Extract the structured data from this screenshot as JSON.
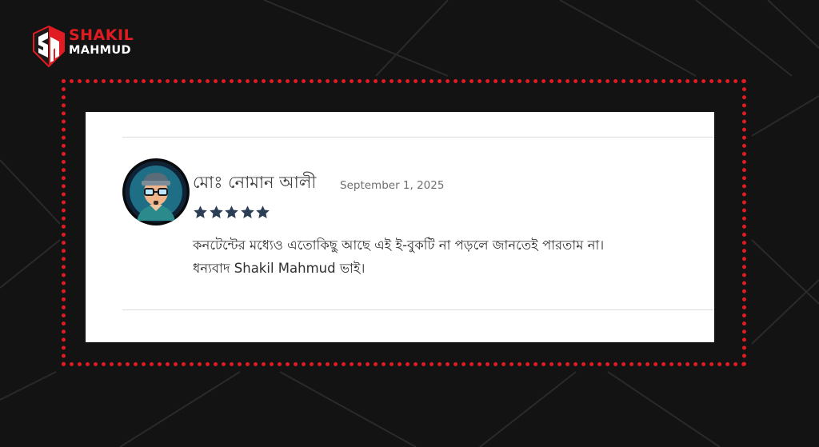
{
  "brand": {
    "line1": "SHAKIL",
    "line2": "MAHMUD",
    "accent_color": "#e11b22"
  },
  "review": {
    "author": "মোঃ নোমান আলী",
    "date": "September 1, 2025",
    "rating": 5,
    "rating_max": 5,
    "star_color": "#2c3e55",
    "text_line1": "কনটেন্টের মধ্যেও এতোকিছু আছে এই ই-বুকটি না পড়লে জানতেই পারতাম না।",
    "text_line2": "ধন্যবাদ Shakil Mahmud ভাই।"
  },
  "icons": {
    "logo": "sm-monogram-icon",
    "avatar": "cartoon-man-with-glasses-avatar",
    "star": "star-icon"
  }
}
